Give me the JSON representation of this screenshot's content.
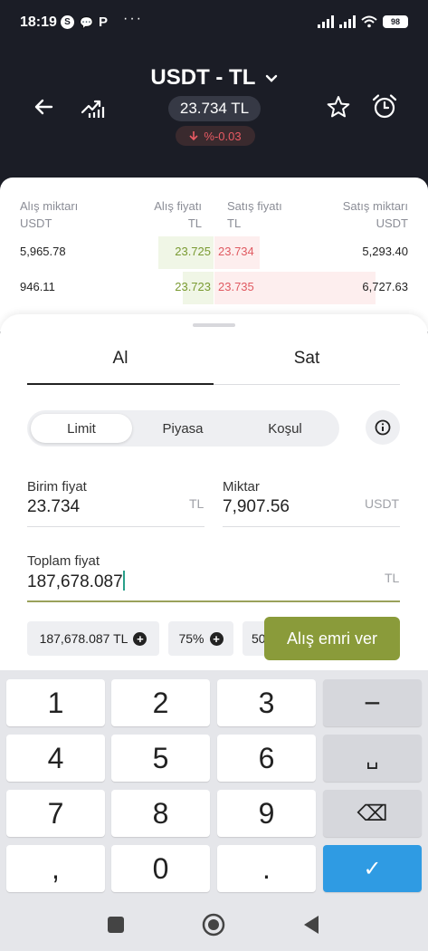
{
  "status_bar": {
    "time": "18:19",
    "notif_icons": [
      "S",
      "💬",
      "Р"
    ],
    "more": "···",
    "battery": "98"
  },
  "header": {
    "title": "USDT - TL",
    "price": "23.734 TL",
    "change": "%-0.03",
    "change_color": "#e85a63"
  },
  "order_book": {
    "headers": {
      "bid_amount": [
        "Alış miktarı",
        "USDT"
      ],
      "bid_price": [
        "Alış fiyatı",
        "TL"
      ],
      "ask_price": [
        "Satış fiyatı",
        "TL"
      ],
      "ask_amount": [
        "Satış miktarı",
        "USDT"
      ]
    },
    "rows": [
      {
        "bid_amount": "5,965.78",
        "bid_price": "23.725",
        "ask_price": "23.734",
        "ask_amount": "5,293.40"
      },
      {
        "bid_amount": "946.11",
        "bid_price": "23.723",
        "ask_price": "23.735",
        "ask_amount": "6,727.63"
      }
    ]
  },
  "order_form": {
    "tabs": [
      "Al",
      "Sat"
    ],
    "active_tab": "Al",
    "order_types": [
      "Limit",
      "Piyasa",
      "Koşul"
    ],
    "active_order_type": "Limit",
    "unit_price": {
      "label": "Birim fiyat",
      "value": "23.734",
      "unit": "TL"
    },
    "amount": {
      "label": "Miktar",
      "value": "7,907.56",
      "unit": "USDT"
    },
    "total": {
      "label": "Toplam fiyat",
      "value": "187,678.087",
      "unit": "TL"
    },
    "chips": [
      "187,678.087 TL",
      "75%",
      "50"
    ],
    "submit_label": "Alış emri ver",
    "accent": "#8a9b3a"
  },
  "keyboard": {
    "rows": [
      [
        "1",
        "2",
        "3",
        "−"
      ],
      [
        "4",
        "5",
        "6",
        "␣"
      ],
      [
        "7",
        "8",
        "9",
        "⌫"
      ],
      [
        ",",
        "0",
        ".",
        "✓"
      ]
    ]
  }
}
